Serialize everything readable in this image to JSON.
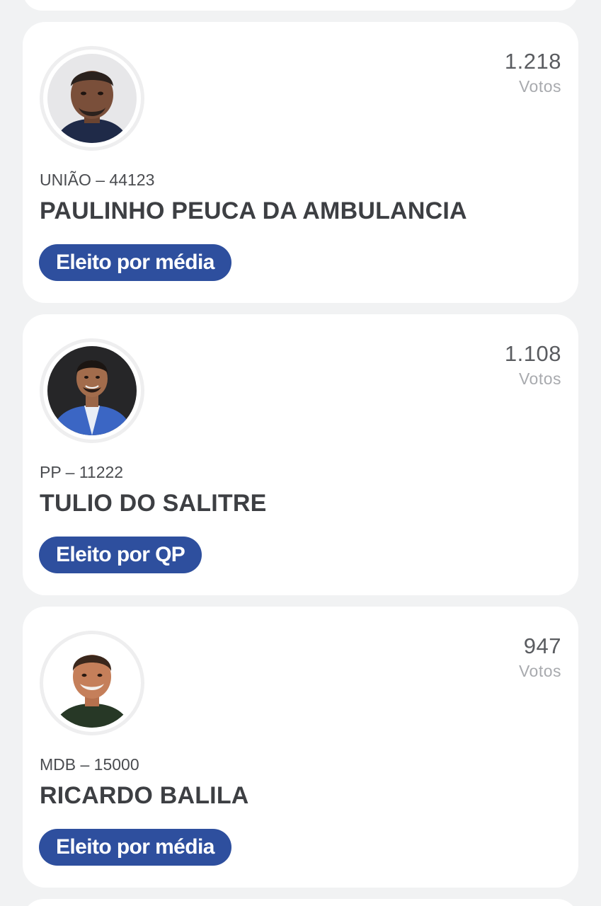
{
  "candidates": [
    {
      "votes": "1.218",
      "votes_label": "Votos",
      "party_number": "UNIÃO – 44123",
      "name": "PAULINHO PEUCA DA AMBULANCIA",
      "status": "Eleito por média"
    },
    {
      "votes": "1.108",
      "votes_label": "Votos",
      "party_number": "PP – 11222",
      "name": "TULIO DO SALITRE",
      "status": "Eleito por QP"
    },
    {
      "votes": "947",
      "votes_label": "Votos",
      "party_number": "MDB – 15000",
      "name": "RICARDO BALILA",
      "status": "Eleito por média"
    }
  ],
  "colors": {
    "background": "#f1f2f3",
    "card": "#ffffff",
    "badge": "#2e4f9e",
    "name_text": "#3d3f43",
    "muted_text": "#a8aaae"
  }
}
